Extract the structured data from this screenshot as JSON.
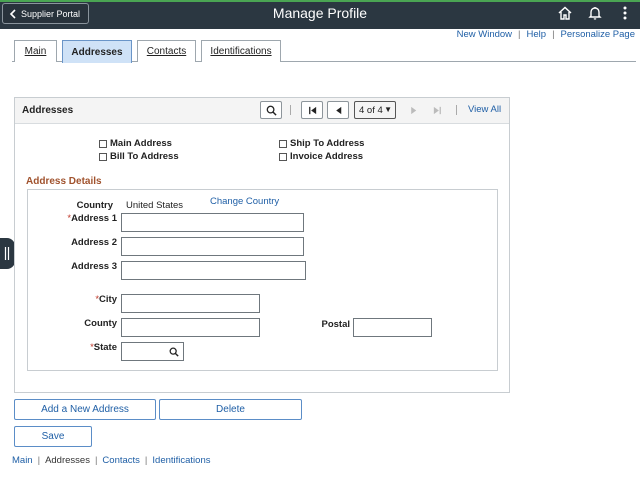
{
  "header": {
    "back_label": "Supplier Portal",
    "title": "Manage Profile",
    "icons": [
      "home-icon",
      "bell-icon",
      "more-vertical-icon"
    ]
  },
  "toplinks": [
    "New Window",
    "Help",
    "Personalize Page"
  ],
  "tabs": [
    {
      "label": "Main",
      "active": false
    },
    {
      "label": "Addresses",
      "active": true
    },
    {
      "label": "Contacts",
      "active": false
    },
    {
      "label": "Identifications",
      "active": false
    }
  ],
  "panel": {
    "title": "Addresses",
    "page_value": "4 of 4",
    "view_all": "View All"
  },
  "checkboxes": {
    "main_address": "Main Address",
    "bill_to": "Bill To Address",
    "ship_to": "Ship To Address",
    "invoice": "Invoice Address"
  },
  "details": {
    "section_title": "Address Details",
    "country_label": "Country",
    "country_value": "United States",
    "change_country": "Change Country",
    "address1_label": "Address 1",
    "address2_label": "Address 2",
    "address3_label": "Address 3",
    "city_label": "City",
    "county_label": "County",
    "postal_label": "Postal",
    "state_label": "State",
    "required_mark": "*"
  },
  "buttons": {
    "add_new": "Add a New Address",
    "delete": "Delete",
    "save": "Save"
  },
  "bottomlinks": [
    {
      "label": "Main",
      "link": true
    },
    {
      "label": "Addresses",
      "link": false
    },
    {
      "label": "Contacts",
      "link": true
    },
    {
      "label": "Identifications",
      "link": true
    }
  ],
  "colors": {
    "header_bg": "#2b3741",
    "accent_green": "#4aa553",
    "link_blue": "#1f5fa6",
    "section_title": "#a0522d"
  }
}
